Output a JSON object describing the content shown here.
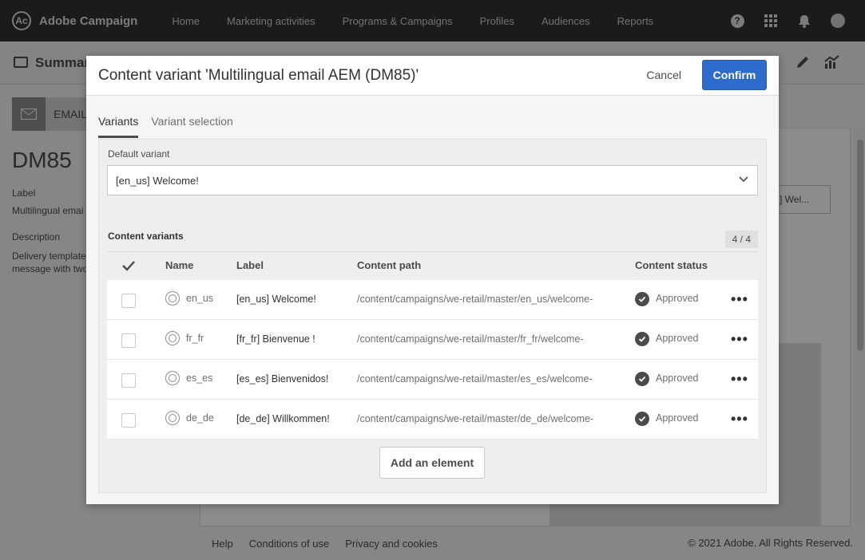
{
  "app": {
    "name": "Adobe Campaign",
    "logo_glyph": "Ac"
  },
  "nav": {
    "items": [
      "Home",
      "Marketing activities",
      "Programs & Campaigns",
      "Profiles",
      "Audiences",
      "Reports"
    ]
  },
  "top_icons": {
    "help": "?",
    "apps": "apps-grid-icon",
    "notifications": "bell-icon",
    "avatar": "user-avatar"
  },
  "background": {
    "subbar_title": "Summar",
    "email_tile": "EMAIL",
    "title": "DM85",
    "label_heading": "Label",
    "label_value": "Multilingual emai",
    "description_heading": "Description",
    "description_value": "Delivery template message with two",
    "select_value": "] Wel..."
  },
  "footer": {
    "links": [
      "Help",
      "Conditions of use",
      "Privacy and cookies"
    ],
    "copyright": "© 2021 Adobe. All Rights Reserved."
  },
  "dialog": {
    "title": "Content variant 'Multilingual email AEM (DM85)'",
    "cancel_label": "Cancel",
    "confirm_label": "Confirm",
    "tabs": [
      "Variants",
      "Variant selection"
    ],
    "default_variant_label": "Default variant",
    "default_variant_value": "[en_us] Welcome!",
    "content_variants_label": "Content variants",
    "count": "4 / 4",
    "columns": {
      "name": "Name",
      "label": "Label",
      "path": "Content path",
      "status": "Content status"
    },
    "rows": [
      {
        "name": "en_us",
        "label": "[en_us] Welcome!",
        "path": "/content/campaigns/we-retail/master/en_us/welcome-",
        "status": "Approved"
      },
      {
        "name": "fr_fr",
        "label": "[fr_fr] Bienvenue !",
        "path": "/content/campaigns/we-retail/master/fr_fr/welcome-",
        "status": "Approved"
      },
      {
        "name": "es_es",
        "label": "[es_es] Bienvenidos!",
        "path": "/content/campaigns/we-retail/master/es_es/welcome-",
        "status": "Approved"
      },
      {
        "name": "de_de",
        "label": "[de_de] Willkommen!",
        "path": "/content/campaigns/we-retail/master/de_de/welcome-",
        "status": "Approved"
      }
    ],
    "more_glyph": "•••",
    "add_element_label": "Add an element"
  },
  "colors": {
    "topbar": "#323232",
    "confirm": "#2d6ccd",
    "overlay": "rgba(0,0,0,0.45)"
  }
}
